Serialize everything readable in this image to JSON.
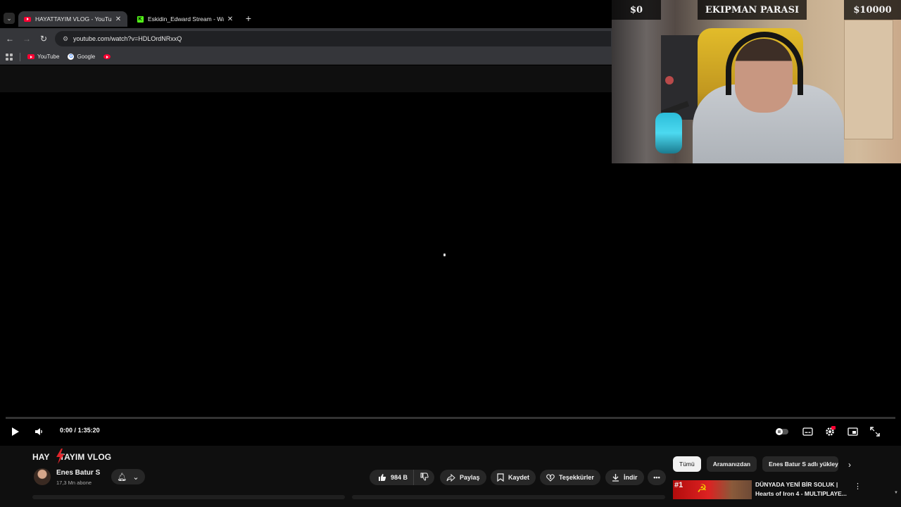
{
  "browser": {
    "tabs": [
      {
        "title": "HAYATTAYIM VLOG - YouTube",
        "active": true,
        "favicon": "youtube-icon"
      },
      {
        "title": "Eskidin_Edward Stream - Watch",
        "active": false,
        "favicon": "kick-icon"
      }
    ],
    "url": "youtube.com/watch?v=HDLOrdNRxxQ",
    "bookmarks": [
      {
        "label": "YouTube",
        "icon": "youtube-icon"
      },
      {
        "label": "Google",
        "icon": "google-icon"
      },
      {
        "label": "",
        "icon": "youtube-music-icon"
      }
    ]
  },
  "player": {
    "time_current": "0:00",
    "time_separator": "/",
    "time_total": "1:35:20",
    "progress_fraction": 0.0
  },
  "video": {
    "title_left": "HAY",
    "title_right": "TAYIM VLOG",
    "channel_name": "Enes Batur S",
    "subscribers": "17,3 Mn abone"
  },
  "actions": {
    "likes": "984 B",
    "share": "Paylaş",
    "save": "Kaydet",
    "thanks": "Teşekkürler",
    "download": "İndir"
  },
  "chips": [
    "Tümü",
    "Aramanızdan",
    "Enes Batur S adlı yükleyici"
  ],
  "recommendation": {
    "rank": "#1",
    "title_line1": "DÜNYADA YENİ BİR SOLUK |",
    "title_line2": "Hearts of Iron 4 - MULTIPLAYE..."
  },
  "overlay": {
    "min_amount": "$0",
    "label": "EKIPMAN PARASI",
    "max_amount": "$10000"
  },
  "colors": {
    "youtube_red": "#ff0033",
    "kick_green": "#53fc18",
    "chrome_toolbar": "#35363a",
    "page_bg": "#0f0f0f",
    "chip_bg": "#272727"
  }
}
